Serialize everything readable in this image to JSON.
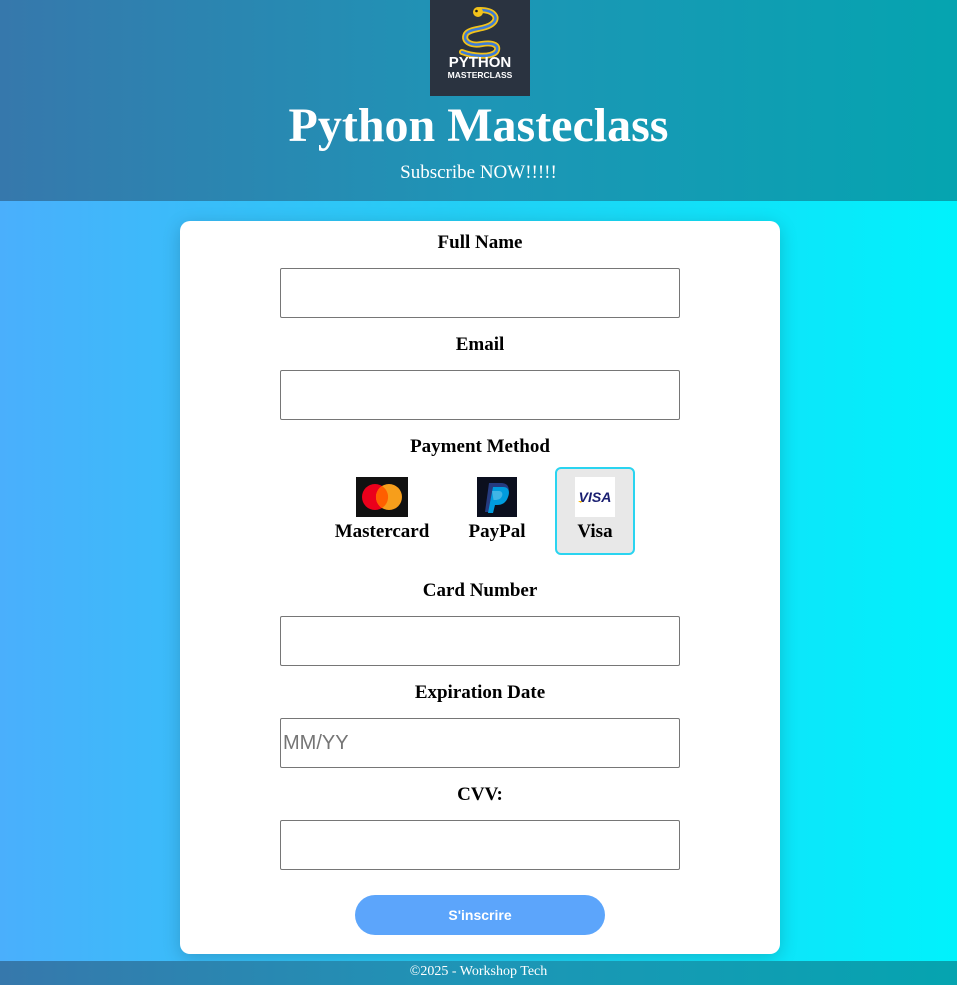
{
  "header": {
    "logo_text_line1": "PYTHON",
    "logo_text_line2": "MASTERCLASS",
    "title": "Python Masteclass",
    "subtitle": "Subscribe NOW!!!!!"
  },
  "form": {
    "full_name": {
      "label": "Full Name",
      "value": "",
      "placeholder": ""
    },
    "email": {
      "label": "Email",
      "value": "",
      "placeholder": ""
    },
    "payment_method": {
      "label": "Payment Method",
      "selected": "Visa",
      "options": [
        {
          "label": "Mastercard",
          "icon": "mastercard-icon"
        },
        {
          "label": "PayPal",
          "icon": "paypal-icon"
        },
        {
          "label": "Visa",
          "icon": "visa-icon",
          "icon_text": "VISA"
        }
      ]
    },
    "card_number": {
      "label": "Card Number",
      "value": "",
      "placeholder": ""
    },
    "expiration_date": {
      "label": "Expiration Date",
      "value": "",
      "placeholder": "MM/YY"
    },
    "cvv": {
      "label": "CVV:",
      "value": "",
      "placeholder": ""
    },
    "submit_label": "S'inscrire"
  },
  "footer": {
    "text": "©2025 - Workshop Tech"
  },
  "colors": {
    "header_bg": "#1e95b6",
    "body_gradient_start": "#4aaffc",
    "body_gradient_end": "#00f2fc",
    "submit_button": "#5ca5fb",
    "selected_border": "#2ad4f0",
    "mastercard_red": "#eb001b",
    "mastercard_orange": "#f79e1b",
    "paypal_blue": "#009cde",
    "visa_blue": "#1a1f71"
  }
}
